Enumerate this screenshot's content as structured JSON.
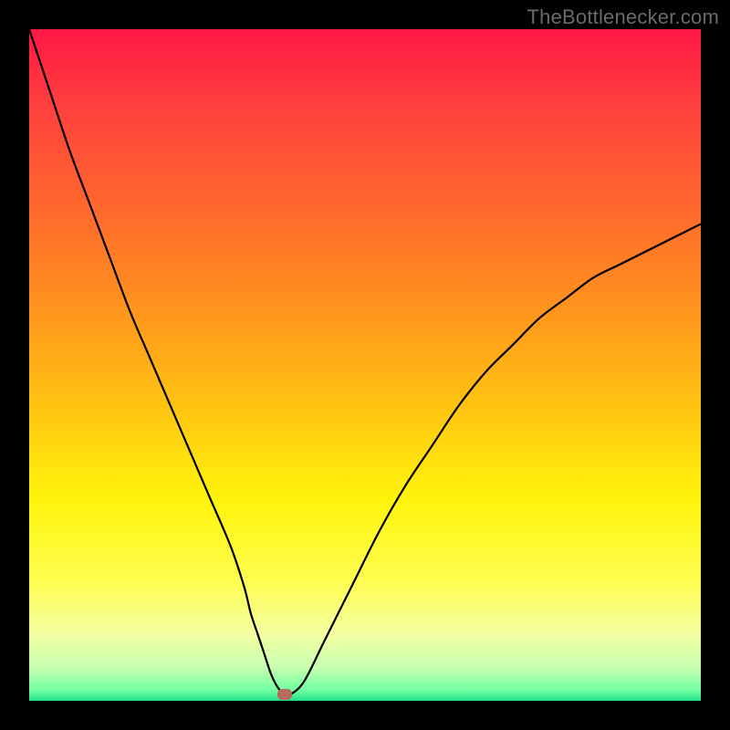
{
  "watermark": "TheBottlenecker.com",
  "chart_data": {
    "type": "line",
    "title": "",
    "xlabel": "",
    "ylabel": "",
    "xlim": [
      0,
      100
    ],
    "ylim": [
      0,
      100
    ],
    "background_gradient": {
      "direction": "vertical",
      "stops": [
        {
          "pos": 0.0,
          "color": "#ff1744"
        },
        {
          "pos": 0.1,
          "color": "#ff3c3f"
        },
        {
          "pos": 0.25,
          "color": "#ff642f"
        },
        {
          "pos": 0.4,
          "color": "#ff8f1f"
        },
        {
          "pos": 0.55,
          "color": "#ffc012"
        },
        {
          "pos": 0.7,
          "color": "#fff40a"
        },
        {
          "pos": 0.82,
          "color": "#fffe50"
        },
        {
          "pos": 0.9,
          "color": "#f4ffa0"
        },
        {
          "pos": 0.95,
          "color": "#c8ffb0"
        },
        {
          "pos": 0.985,
          "color": "#6effa0"
        },
        {
          "pos": 1.0,
          "color": "#21e08b"
        }
      ]
    },
    "series": [
      {
        "name": "bottleneck-curve",
        "color": "#000000",
        "stroke_width": 2.2,
        "x": [
          0,
          3,
          6,
          9,
          12,
          15,
          18,
          21,
          24,
          27,
          30,
          32,
          33,
          34,
          35,
          36,
          37,
          38,
          39,
          41,
          44,
          48,
          52,
          56,
          60,
          64,
          68,
          72,
          76,
          80,
          84,
          88,
          92,
          96,
          100
        ],
        "values": [
          100,
          91,
          82,
          74,
          66,
          58,
          51,
          44,
          37,
          30,
          23,
          17,
          13,
          10,
          7,
          4,
          2,
          1,
          1,
          3,
          9,
          17,
          25,
          32,
          38,
          44,
          49,
          53,
          57,
          60,
          63,
          65,
          67,
          69,
          71
        ]
      }
    ],
    "marker": {
      "x": 38,
      "y": 1,
      "color": "#b86a5f"
    }
  }
}
